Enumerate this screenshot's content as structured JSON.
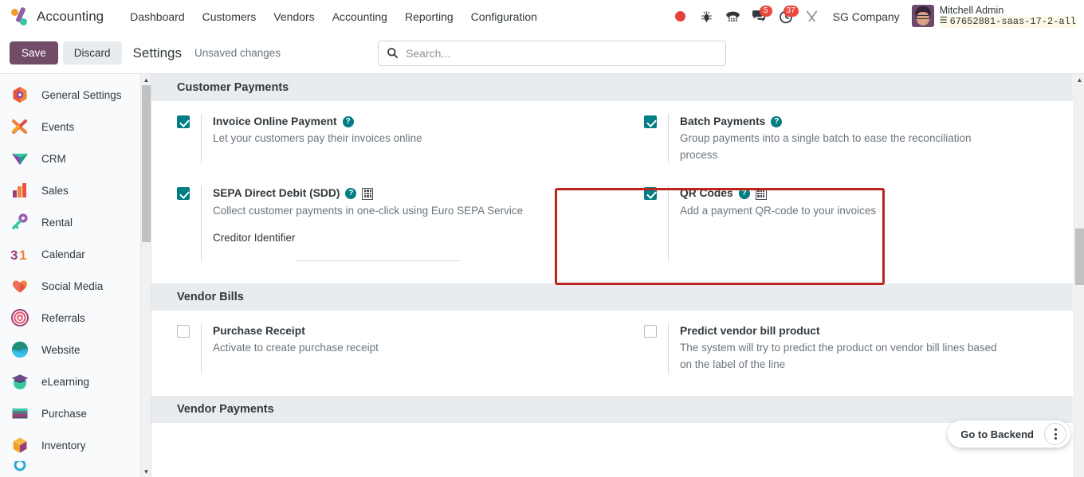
{
  "navbar": {
    "brand": "Accounting",
    "menu": [
      {
        "label": "Dashboard"
      },
      {
        "label": "Customers"
      },
      {
        "label": "Vendors"
      },
      {
        "label": "Accounting"
      },
      {
        "label": "Reporting"
      },
      {
        "label": "Configuration"
      }
    ],
    "systray": {
      "record_icon": "record-dot-icon",
      "bug_icon": "bug-icon",
      "phone_icon": "voip-phone-icon",
      "messages_icon": "messages-icon",
      "messages_count": "5",
      "activities_icon": "activities-clock-icon",
      "activities_count": "37",
      "tools_icon": "tools-icon",
      "company": "SG Company"
    },
    "user": {
      "name": "Mitchell Admin",
      "database": "67652881-saas-17-2-all",
      "db_icon": "database-icon",
      "avatar": "user-avatar"
    }
  },
  "control_panel": {
    "save_label": "Save",
    "discard_label": "Discard",
    "title": "Settings",
    "status": "Unsaved changes",
    "search_placeholder": "Search...",
    "search_value": "",
    "search_icon": "search-icon"
  },
  "sidebar": {
    "items": [
      {
        "label": "General Settings",
        "icon": "general-settings-icon"
      },
      {
        "label": "Events",
        "icon": "events-icon"
      },
      {
        "label": "CRM",
        "icon": "crm-icon"
      },
      {
        "label": "Sales",
        "icon": "sales-icon"
      },
      {
        "label": "Rental",
        "icon": "rental-icon"
      },
      {
        "label": "Calendar",
        "icon": "calendar-icon"
      },
      {
        "label": "Social Media",
        "icon": "social-media-icon"
      },
      {
        "label": "Referrals",
        "icon": "referrals-icon"
      },
      {
        "label": "Website",
        "icon": "website-icon"
      },
      {
        "label": "eLearning",
        "icon": "elearning-icon"
      },
      {
        "label": "Purchase",
        "icon": "purchase-icon"
      },
      {
        "label": "Inventory",
        "icon": "inventory-icon"
      }
    ],
    "scroll_up": "▲",
    "scroll_down": "▼"
  },
  "settings": {
    "sections": [
      {
        "title": "Customer Payments",
        "rows": [
          {
            "left": {
              "name": "invoice-online-payment",
              "checked": true,
              "title": "Invoice Online Payment",
              "desc": "Let your customers pay their invoices online",
              "help": true,
              "company_scope": false
            },
            "right": {
              "name": "batch-payments",
              "checked": true,
              "title": "Batch Payments",
              "desc": "Group payments into a single batch to ease the reconciliation process",
              "help": true,
              "company_scope": false
            }
          },
          {
            "left": {
              "name": "sepa-direct-debit",
              "checked": true,
              "title": "SEPA Direct Debit (SDD)",
              "desc": "Collect customer payments in one-click using Euro SEPA Service",
              "help": true,
              "company_scope": true,
              "subfield_label": "Creditor Identifier",
              "subfield_value": "",
              "subfield_placeholder": ""
            },
            "right": {
              "name": "qr-codes",
              "checked": true,
              "title": "QR Codes",
              "desc": "Add a payment QR-code to your invoices",
              "help": true,
              "company_scope": true,
              "highlighted": true
            }
          }
        ]
      },
      {
        "title": "Vendor Bills",
        "rows": [
          {
            "left": {
              "name": "purchase-receipt",
              "checked": false,
              "title": "Purchase Receipt",
              "desc": "Activate to create purchase receipt",
              "help": false,
              "company_scope": false
            },
            "right": {
              "name": "predict-vendor-bill-product",
              "checked": false,
              "title": "Predict vendor bill product",
              "desc": "The system will try to predict the product on vendor bill lines based on the label of the line",
              "help": false,
              "company_scope": false
            }
          }
        ]
      },
      {
        "title": "Vendor Payments",
        "rows": []
      }
    ],
    "help_glyph": "?",
    "highlight_color": "#c0221c"
  },
  "backend": {
    "label": "Go to Backend",
    "menu_icon": "kebab-menu-icon"
  }
}
